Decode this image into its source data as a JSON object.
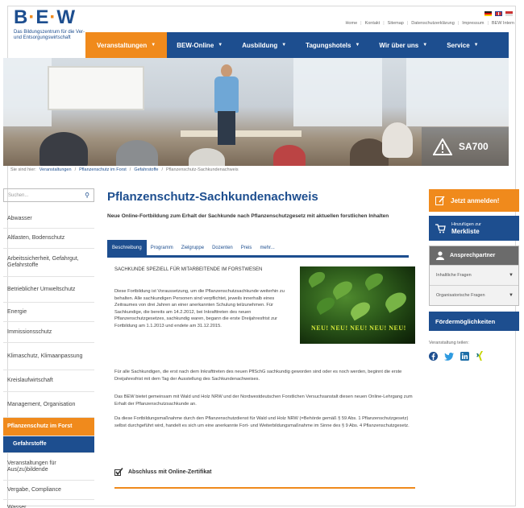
{
  "brand": {
    "logo_text": "B·E·W",
    "tagline": "Das Bildungszentrum für die Ver- und Entsorgungswirtschaft"
  },
  "top_links": [
    "Home",
    "Kontakt",
    "Sitemap",
    "Datenschutzerklärung",
    "Impressum",
    "BEW Intern"
  ],
  "nav": [
    {
      "label": "Veranstaltungen",
      "active": true
    },
    {
      "label": "BEW-Online",
      "active": false
    },
    {
      "label": "Ausbildung",
      "active": false
    },
    {
      "label": "Tagungshotels",
      "active": false
    },
    {
      "label": "Wir über uns",
      "active": false
    },
    {
      "label": "Service",
      "active": false
    }
  ],
  "hero": {
    "badge": "SA700"
  },
  "breadcrumb": {
    "prefix": "Sie sind hier:",
    "items": [
      "Veranstaltungen",
      "Pflanzenschutz im Forst",
      "Gefahrstoffe",
      "Pflanzenschutz-Sachkundenachweis"
    ]
  },
  "sidebar": {
    "search_placeholder": "Suchen...",
    "items": [
      {
        "label": "Abwasser",
        "style": "normal"
      },
      {
        "label": "Altlasten, Bodenschutz",
        "style": "normal"
      },
      {
        "label": "Arbeitssicherheit, Gefahrgut, Gefahrstoffe",
        "style": "normal"
      },
      {
        "label": "Betrieblicher Umweltschutz",
        "style": "normal"
      },
      {
        "label": "Energie",
        "style": "normal"
      },
      {
        "label": "Immissionsschutz",
        "style": "normal"
      },
      {
        "label": "Klimaschutz, Klimaanpassung",
        "style": "normal"
      },
      {
        "label": "Kreislaufwirtschaft",
        "style": "normal"
      },
      {
        "label": "Management, Organisation",
        "style": "normal"
      },
      {
        "label": "Pflanzenschutz im Forst",
        "style": "orange"
      },
      {
        "label": "Gefahrstoffe",
        "style": "navy"
      },
      {
        "label": "Veranstaltungen für Aus(zu)bildende",
        "style": "normal"
      },
      {
        "label": "Vergabe, Compliance",
        "style": "normal"
      },
      {
        "label": "Wasser",
        "style": "normal"
      }
    ]
  },
  "main": {
    "title": "Pflanzenschutz-Sachkundenachweis",
    "lead": "Neue Online-Fortbildung zum Erhalt der Sachkunde nach Pflanzenschutzgesetz mit aktuellen forstlichen Inhalten",
    "tabs": [
      "Beschreibung",
      "Programm",
      "Zielgruppe",
      "Dozenten",
      "Preis",
      "mehr..."
    ],
    "section_heading": "SACHKUNDE SPEZIELL FÜR MITARBEITENDE IM FORSTWESEN",
    "para1": "Diese Fortbildung ist Voraussetzung, um die Pflanzenschutzsachkunde weiterhin zu behalten. Alle sachkundigen Personen sind verpflichtet, jeweils innerhalb eines Zeitraumes von drei Jahren an einer anerkannten Schulung teilzunehmen. Für Sachkundige, die bereits am 14.2.2012, bei Inkrafttreten des neuen Pflanzenschutzgesetzes, sachkundig waren, begann die erste Dreijahresfrist zur Fortbildung am 1.1.2013 und endete am 31.12.2015.",
    "photo_caption": "NEU! NEU! NEU! NEU! NEU!",
    "para2": "Für alle Sachkundigen, die erst nach dem Inkrafttreten des neuen PflSchG sachkundig geworden sind oder es noch werden, beginnt die erste Dreijahresfrist mit dem Tag der Ausstellung des Sachkundenachweises.",
    "para3": "Das BEW bietet gemeinsam mit Wald und Holz NRW und der Nordwestdeutschen Forstlichen Versuchsanstalt diesen neuen Online-Lehrgang zum Erhalt der Pflanzenschutzsachkunde an.",
    "para4": "Da diese Fortbildungsmaßnahme durch den Pflanzenschutzdienst für Wald und Holz NRW (=Behörde gemäß § 59 Abs. 1 Pflanzenschutzgesetz) selbst durchgeführt wird, handelt es sich um eine anerkannte Fort- und Weiterbildungsmaßnahme im Sinne des § 9 Abs. 4 Pflanzenschutzgesetz.",
    "certificate": "Abschluss mit Online-Zertifikat"
  },
  "right": {
    "register": "Jetzt anmelden!",
    "watch_small": "Hinzufügen zur",
    "watch_big": "Merkliste",
    "contact_title": "Ansprechpartner",
    "contact_rows": [
      "Inhaltliche Fragen",
      "Organisatorische Fragen"
    ],
    "funding": "Fördermöglichkeiten",
    "share_label": "Veranstaltung teilen:"
  },
  "colors": {
    "navy": "#1d4e8f",
    "orange": "#f08a1c",
    "grey": "#6b6b6b"
  }
}
